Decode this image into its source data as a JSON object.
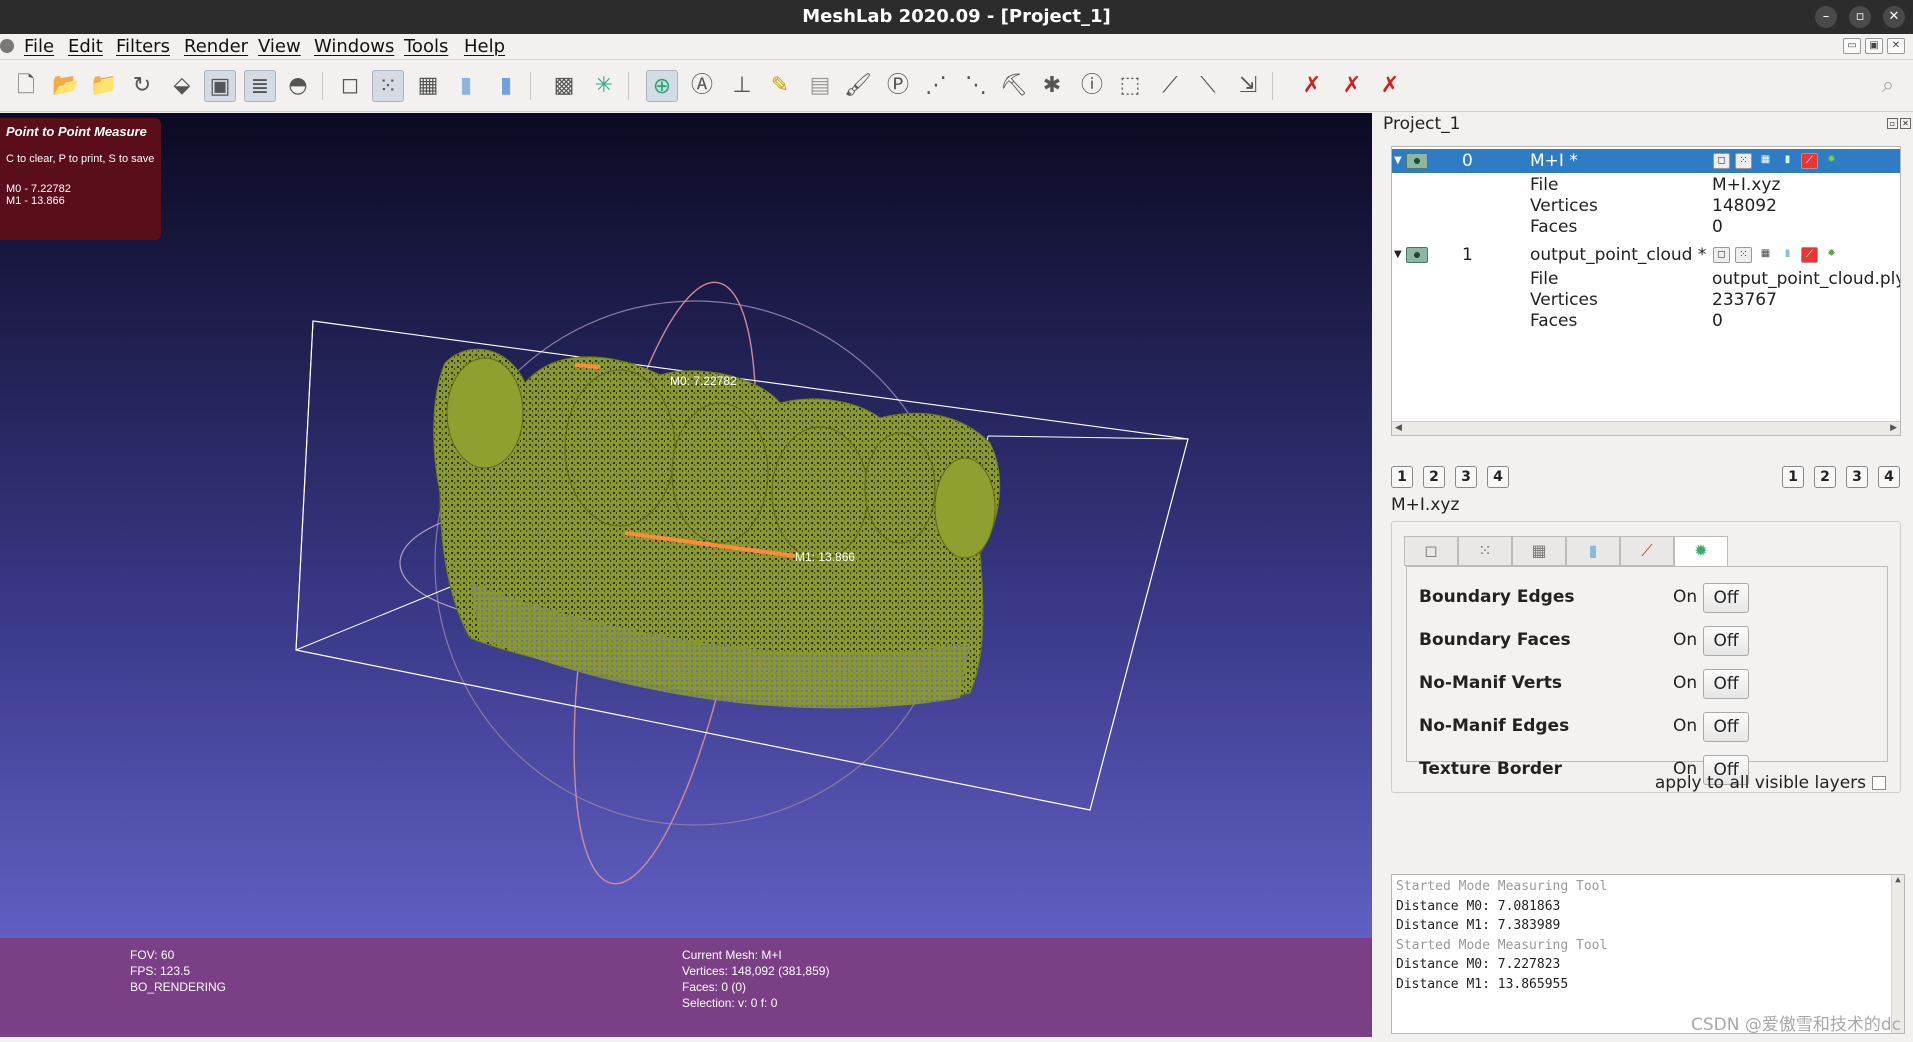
{
  "window": {
    "title": "MeshLab 2020.09 - [Project_1]"
  },
  "menu": [
    "File",
    "Edit",
    "Filters",
    "Render",
    "View",
    "Windows",
    "Tools",
    "Help"
  ],
  "toolbar": {
    "icons": [
      "new-project-icon",
      "open-project-icon",
      "import-mesh-icon",
      "reload-icon",
      "export-mesh-icon",
      "snapshot-icon",
      "layer-dialog-icon",
      "raster-icon",
      "bbox-icon",
      "points-icon",
      "wireframe-icon",
      "flat-icon",
      "smooth-icon",
      "colormode-icon",
      "axes-icon",
      "select-faces-icon",
      "annotation-icon",
      "measure-icon",
      "pick-point-icon",
      "align-icon",
      "paint-icon",
      "reference-icon",
      "vertex-select-icon",
      "face-select-icon",
      "fill-icon",
      "georef-icon",
      "info-icon",
      "select-region-icon",
      "edit-1-icon",
      "edit-2-icon",
      "edit-3-icon",
      "delete-vert-icon",
      "delete-face-icon",
      "delete-all-icon",
      "search-icon"
    ]
  },
  "viewport": {
    "measure": {
      "title": "Point to Point Measure",
      "hint": "C to clear, P to print, S to save",
      "m0": "M0 - 7.22782",
      "m1": "M1 - 13.866"
    },
    "labels": {
      "m0": "M0: 7.22782",
      "m1": "M1: 13.866"
    },
    "status_left": [
      "FOV: 60",
      "FPS:   123.5",
      "BO_RENDERING"
    ],
    "status_mid": [
      "Current Mesh: M+I",
      "Vertices: 148,092    (381,859)",
      "Faces: 0    (0)",
      "Selection: v: 0 f: 0"
    ]
  },
  "panel": {
    "title": "Project_1",
    "layers": [
      {
        "index": "0",
        "name": "M+I *",
        "file_label": "File",
        "file": "M+I.xyz",
        "vertices_label": "Vertices",
        "vertices": "148092",
        "faces_label": "Faces",
        "faces": "0"
      },
      {
        "index": "1",
        "name": "output_point_cloud *",
        "file_label": "File",
        "file": "output_point_cloud.ply",
        "vertices_label": "Vertices",
        "vertices": "233767",
        "faces_label": "Faces",
        "faces": "0"
      }
    ],
    "left_numbers": [
      "1",
      "2",
      "3",
      "4"
    ],
    "right_numbers": [
      "1",
      "2",
      "3",
      "4"
    ],
    "selected_file": "M+I.xyz",
    "decorators": [
      {
        "label": "Boundary Edges",
        "on": "On",
        "off": "Off"
      },
      {
        "label": "Boundary Faces",
        "on": "On",
        "off": "Off"
      },
      {
        "label": "No-Manif Verts",
        "on": "On",
        "off": "Off"
      },
      {
        "label": "No-Manif Edges",
        "on": "On",
        "off": "Off"
      },
      {
        "label": "Texture Border",
        "on": "On",
        "off": "Off"
      }
    ],
    "apply_all": "apply to all visible layers",
    "log": [
      {
        "text": "Started Mode Measuring Tool",
        "muted": true
      },
      {
        "text": "Distance M0: 7.081863",
        "muted": false
      },
      {
        "text": "Distance M1: 7.383989",
        "muted": false
      },
      {
        "text": "Started Mode Measuring Tool",
        "muted": true
      },
      {
        "text": "Distance M0: 7.227823",
        "muted": false
      },
      {
        "text": "Distance M1: 13.865955",
        "muted": false
      }
    ]
  },
  "watermark": "CSDN @爱傲雪和技术的dc",
  "colors": {
    "mesh": "#8f9f2e",
    "selection": "#2e7dc4",
    "status_band": "#7b3f86",
    "measure_line": "#ff8a3c"
  }
}
